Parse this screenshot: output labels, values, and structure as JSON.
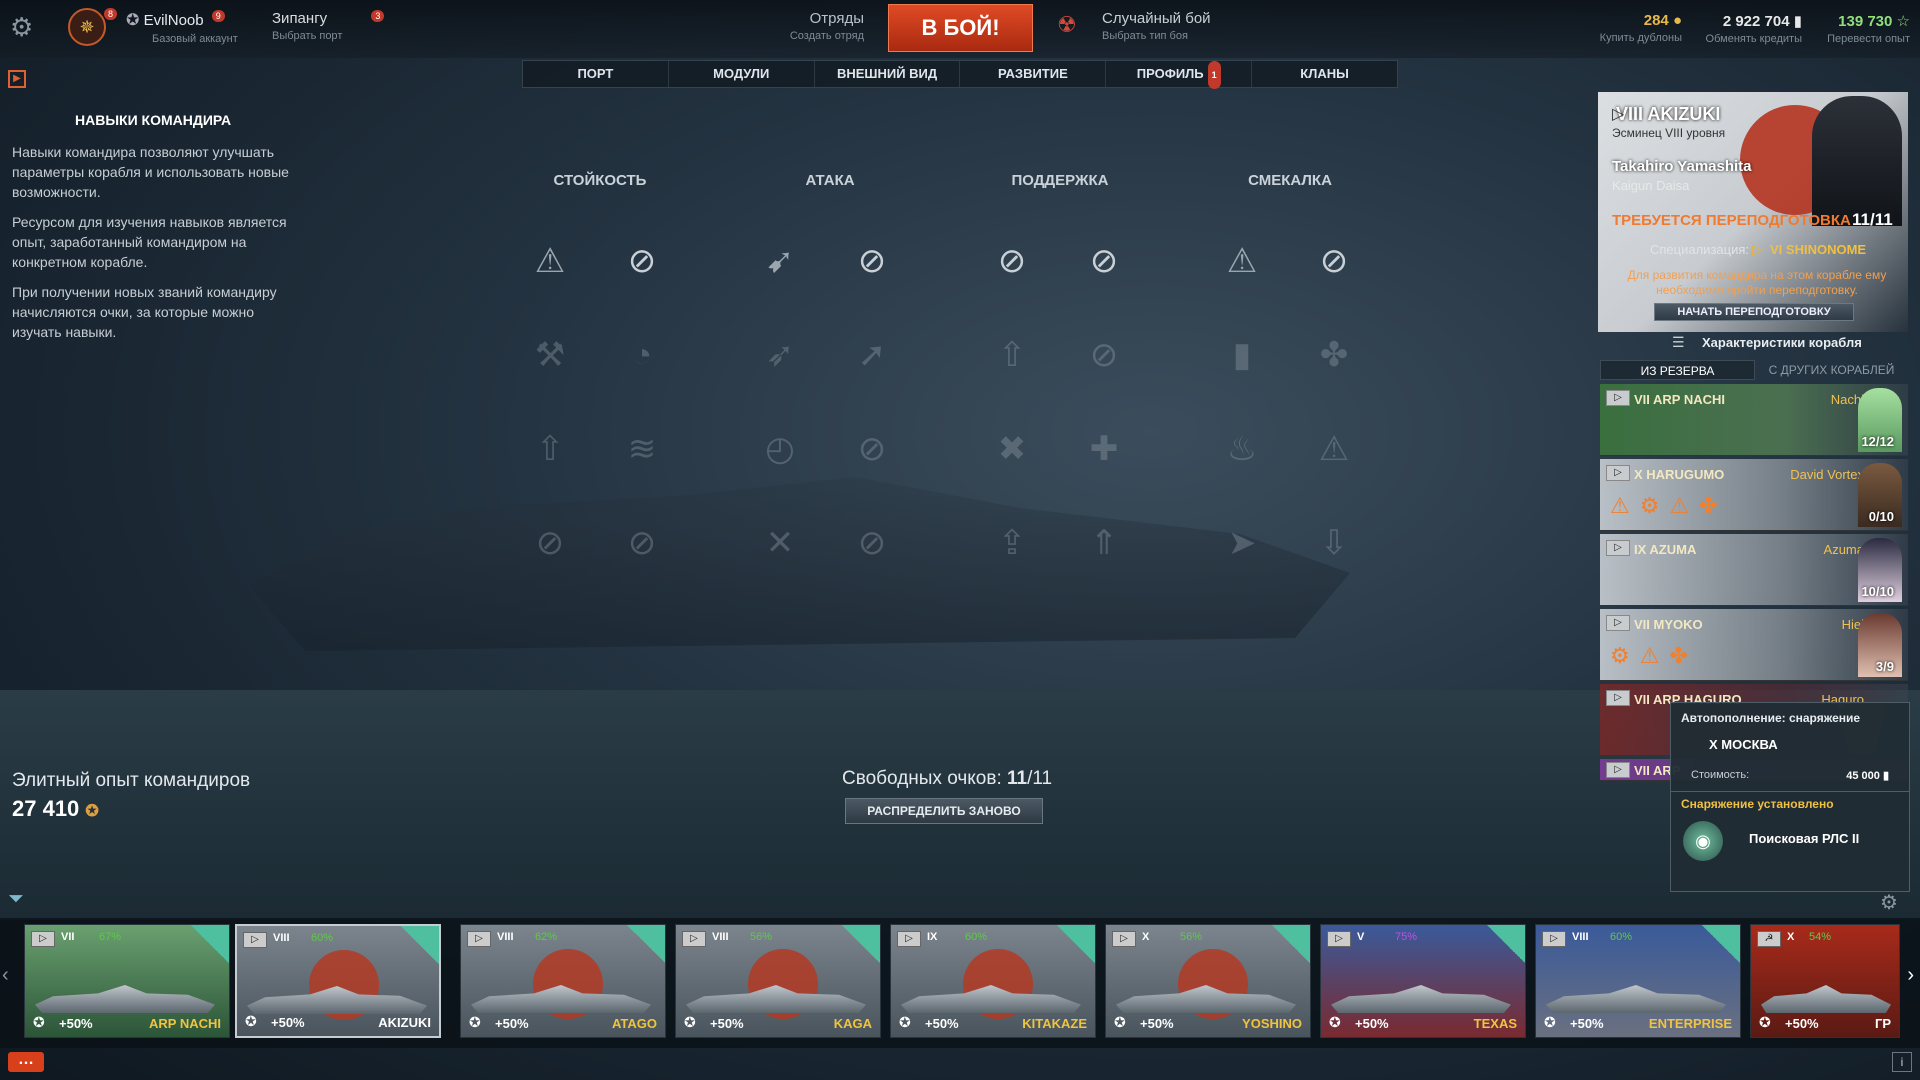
{
  "topbar": {
    "player_name": "EvilNoob",
    "player_badge": "9",
    "player_sub": "Базовый аккаунт",
    "rank_badge": "8",
    "port_name": "Зипангу",
    "port_badge": "3",
    "port_sub": "Выбрать порт",
    "divisions": "Отряды",
    "divisions_sub": "Создать отряд",
    "battle_button": "В БОЙ!",
    "mode": "Случайный бой",
    "mode_sub": "Выбрать тип боя",
    "doubloons": "284",
    "doubloons_sub": "Купить дублоны",
    "credits": "2 922 704",
    "credits_sub": "Обменять кредиты",
    "free_xp": "139 730",
    "free_xp_sub": "Перевести опыт"
  },
  "nav": {
    "port": "ПОРТ",
    "modules": "МОДУЛИ",
    "exterior": "ВНЕШНИЙ ВИД",
    "development": "РАЗВИТИЕ",
    "profile": "ПРОФИЛЬ",
    "profile_badge": "1",
    "clans": "КЛАНЫ"
  },
  "left_panel": {
    "title": "НАВЫКИ КОМАНДИРА",
    "p1": "Навыки командира позволяют улучшать параметры корабля и использовать новые возможности.",
    "p2": "Ресурсом для изучения навыков является опыт, заработанный командиром на конкретном корабле.",
    "p3": "При получении новых званий командиру начисляются очки, за которые можно изучать навыки."
  },
  "skills": {
    "columns": [
      "СТОЙКОСТЬ",
      "АТАКА",
      "ПОДДЕРЖКА",
      "СМЕКАЛКА"
    ]
  },
  "bottom": {
    "elite_label": "Элитный опыт командиров",
    "elite_value": "27 410",
    "free_points_label": "Свободных очков:",
    "free_points_value": "11",
    "free_points_total": "/11",
    "redistribute": "РАСПРЕДЕЛИТЬ ЗАНОВО"
  },
  "commander": {
    "ship": "VIII AKIZUKI",
    "ship_sub": "Эсминец VIII уровня",
    "name": "Takahiro Yamashita",
    "rank": "Kaigun Daisa",
    "retrain_warning": "ТРЕБУЕТСЯ ПЕРЕПОДГОТОВКА",
    "points": "11/11",
    "spec_label": "Специализация:",
    "spec_ship": "VI SHINONOME",
    "retrain_note": "Для развития командира на этом корабле ему необходимо пройти переподготовку.",
    "retrain_button": "НАЧАТЬ ПЕРЕПОДГОТОВКУ",
    "ship_stats": "Характеристики корабля",
    "tab_reserve": "ИЗ РЕЗЕРВА",
    "tab_other": "С ДРУГИХ КОРАБЛЕЙ"
  },
  "reserve": [
    {
      "ship": "VII ARP NACHI",
      "cmdr": "Nachi",
      "pts": "12/12"
    },
    {
      "ship": "X HARUGUMO",
      "cmdr": "David Vortex",
      "pts": "0/10"
    },
    {
      "ship": "IX AZUMA",
      "cmdr": "Azuma",
      "pts": "10/10"
    },
    {
      "ship": "VII MYOKO",
      "cmdr": "Hiei",
      "pts": "3/9"
    },
    {
      "ship": "VII ARP HAGURO",
      "cmdr": "Haguro",
      "pts": ""
    },
    {
      "ship": "VII ARP",
      "cmdr": "",
      "pts": ""
    }
  ],
  "popup": {
    "autoresupply": "Автопополнение: снаряжение",
    "ship": "X МОСКВА",
    "cost_label": "Стоимость:",
    "cost_value": "45 000",
    "installed": "Снаряжение установлено",
    "item": "Поисковая РЛС II"
  },
  "carousel": [
    {
      "tier": "VII",
      "pct": "67%",
      "xp": "+50%",
      "name": "ARP NACHI"
    },
    {
      "tier": "VIII",
      "pct": "60%",
      "xp": "+50%",
      "name": "AKIZUKI"
    },
    {
      "tier": "VIII",
      "pct": "62%",
      "xp": "+50%",
      "name": "ATAGO"
    },
    {
      "tier": "VIII",
      "pct": "56%",
      "xp": "+50%",
      "name": "KAGA"
    },
    {
      "tier": "IX",
      "pct": "60%",
      "xp": "+50%",
      "name": "KITAKAZE"
    },
    {
      "tier": "X",
      "pct": "56%",
      "xp": "+50%",
      "name": "YOSHINO"
    },
    {
      "tier": "V",
      "pct": "75%",
      "xp": "+50%",
      "name": "TEXAS"
    },
    {
      "tier": "VIII",
      "pct": "60%",
      "xp": "+50%",
      "name": "ENTERPRISE"
    },
    {
      "tier": "X",
      "pct": "54%",
      "xp": "+50%",
      "name": "ГР"
    }
  ]
}
